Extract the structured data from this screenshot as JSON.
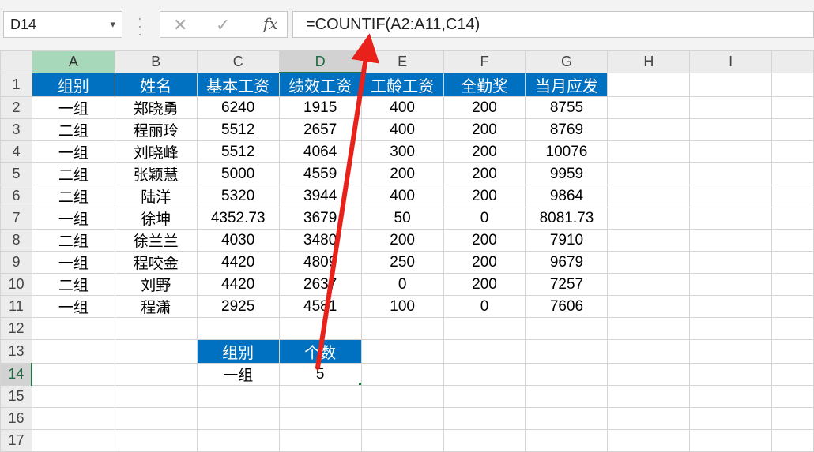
{
  "name_box": "D14",
  "formula_bar": {
    "cancel_symbol": "✕",
    "enter_symbol": "✓",
    "fx_label": "fx",
    "formula": "=COUNTIF(A2:A11,C14)"
  },
  "columns": [
    "A",
    "B",
    "C",
    "D",
    "E",
    "F",
    "G",
    "H",
    "I"
  ],
  "rows": [
    [
      "组别",
      "姓名",
      "基本工资",
      "绩效工资",
      "工龄工资",
      "全勤奖",
      "当月应发",
      "",
      ""
    ],
    [
      "一组",
      "郑晓勇",
      "6240",
      "1915",
      "400",
      "200",
      "8755",
      "",
      ""
    ],
    [
      "二组",
      "程丽玲",
      "5512",
      "2657",
      "400",
      "200",
      "8769",
      "",
      ""
    ],
    [
      "一组",
      "刘晓峰",
      "5512",
      "4064",
      "300",
      "200",
      "10076",
      "",
      ""
    ],
    [
      "二组",
      "张颖慧",
      "5000",
      "4559",
      "200",
      "200",
      "9959",
      "",
      ""
    ],
    [
      "二组",
      "陆洋",
      "5320",
      "3944",
      "400",
      "200",
      "9864",
      "",
      ""
    ],
    [
      "一组",
      "徐坤",
      "4352.73",
      "3679",
      "50",
      "0",
      "8081.73",
      "",
      ""
    ],
    [
      "二组",
      "徐兰兰",
      "4030",
      "3480",
      "200",
      "200",
      "7910",
      "",
      ""
    ],
    [
      "一组",
      "程咬金",
      "4420",
      "4809",
      "250",
      "200",
      "9679",
      "",
      ""
    ],
    [
      "二组",
      "刘野",
      "4420",
      "2637",
      "0",
      "200",
      "7257",
      "",
      ""
    ],
    [
      "一组",
      "程潇",
      "2925",
      "4581",
      "100",
      "0",
      "7606",
      "",
      ""
    ],
    [
      "",
      "",
      "",
      "",
      "",
      "",
      "",
      "",
      ""
    ],
    [
      "",
      "",
      "组别",
      "个数",
      "",
      "",
      "",
      "",
      ""
    ],
    [
      "",
      "",
      "一组",
      "5",
      "",
      "",
      "",
      "",
      ""
    ],
    [
      "",
      "",
      "",
      "",
      "",
      "",
      "",
      "",
      ""
    ],
    [
      "",
      "",
      "",
      "",
      "",
      "",
      "",
      "",
      ""
    ],
    [
      "",
      "",
      "",
      "",
      "",
      "",
      "",
      "",
      ""
    ]
  ],
  "active_cell": "D14",
  "colors": {
    "header_fill": "#0070c0",
    "header_text": "#ffffff",
    "selection": "#217346",
    "arrow": "#e8221b"
  }
}
